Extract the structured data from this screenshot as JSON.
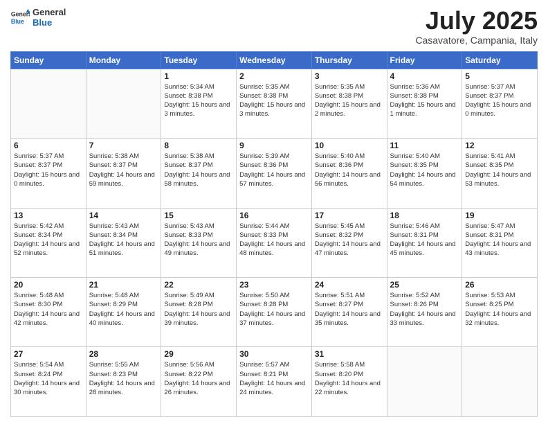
{
  "header": {
    "logo": {
      "general": "General",
      "blue": "Blue"
    },
    "title": "July 2025",
    "location": "Casavatore, Campania, Italy"
  },
  "calendar": {
    "weekdays": [
      "Sunday",
      "Monday",
      "Tuesday",
      "Wednesday",
      "Thursday",
      "Friday",
      "Saturday"
    ],
    "weeks": [
      [
        null,
        null,
        {
          "day": 1,
          "sunrise": "5:34 AM",
          "sunset": "8:38 PM",
          "daylight": "15 hours and 3 minutes."
        },
        {
          "day": 2,
          "sunrise": "5:35 AM",
          "sunset": "8:38 PM",
          "daylight": "15 hours and 3 minutes."
        },
        {
          "day": 3,
          "sunrise": "5:35 AM",
          "sunset": "8:38 PM",
          "daylight": "15 hours and 2 minutes."
        },
        {
          "day": 4,
          "sunrise": "5:36 AM",
          "sunset": "8:38 PM",
          "daylight": "15 hours and 1 minute."
        },
        {
          "day": 5,
          "sunrise": "5:37 AM",
          "sunset": "8:37 PM",
          "daylight": "15 hours and 0 minutes."
        }
      ],
      [
        {
          "day": 6,
          "sunrise": "5:37 AM",
          "sunset": "8:37 PM",
          "daylight": "15 hours and 0 minutes."
        },
        {
          "day": 7,
          "sunrise": "5:38 AM",
          "sunset": "8:37 PM",
          "daylight": "14 hours and 59 minutes."
        },
        {
          "day": 8,
          "sunrise": "5:38 AM",
          "sunset": "8:37 PM",
          "daylight": "14 hours and 58 minutes."
        },
        {
          "day": 9,
          "sunrise": "5:39 AM",
          "sunset": "8:36 PM",
          "daylight": "14 hours and 57 minutes."
        },
        {
          "day": 10,
          "sunrise": "5:40 AM",
          "sunset": "8:36 PM",
          "daylight": "14 hours and 56 minutes."
        },
        {
          "day": 11,
          "sunrise": "5:40 AM",
          "sunset": "8:35 PM",
          "daylight": "14 hours and 54 minutes."
        },
        {
          "day": 12,
          "sunrise": "5:41 AM",
          "sunset": "8:35 PM",
          "daylight": "14 hours and 53 minutes."
        }
      ],
      [
        {
          "day": 13,
          "sunrise": "5:42 AM",
          "sunset": "8:34 PM",
          "daylight": "14 hours and 52 minutes."
        },
        {
          "day": 14,
          "sunrise": "5:43 AM",
          "sunset": "8:34 PM",
          "daylight": "14 hours and 51 minutes."
        },
        {
          "day": 15,
          "sunrise": "5:43 AM",
          "sunset": "8:33 PM",
          "daylight": "14 hours and 49 minutes."
        },
        {
          "day": 16,
          "sunrise": "5:44 AM",
          "sunset": "8:33 PM",
          "daylight": "14 hours and 48 minutes."
        },
        {
          "day": 17,
          "sunrise": "5:45 AM",
          "sunset": "8:32 PM",
          "daylight": "14 hours and 47 minutes."
        },
        {
          "day": 18,
          "sunrise": "5:46 AM",
          "sunset": "8:31 PM",
          "daylight": "14 hours and 45 minutes."
        },
        {
          "day": 19,
          "sunrise": "5:47 AM",
          "sunset": "8:31 PM",
          "daylight": "14 hours and 43 minutes."
        }
      ],
      [
        {
          "day": 20,
          "sunrise": "5:48 AM",
          "sunset": "8:30 PM",
          "daylight": "14 hours and 42 minutes."
        },
        {
          "day": 21,
          "sunrise": "5:48 AM",
          "sunset": "8:29 PM",
          "daylight": "14 hours and 40 minutes."
        },
        {
          "day": 22,
          "sunrise": "5:49 AM",
          "sunset": "8:28 PM",
          "daylight": "14 hours and 39 minutes."
        },
        {
          "day": 23,
          "sunrise": "5:50 AM",
          "sunset": "8:28 PM",
          "daylight": "14 hours and 37 minutes."
        },
        {
          "day": 24,
          "sunrise": "5:51 AM",
          "sunset": "8:27 PM",
          "daylight": "14 hours and 35 minutes."
        },
        {
          "day": 25,
          "sunrise": "5:52 AM",
          "sunset": "8:26 PM",
          "daylight": "14 hours and 33 minutes."
        },
        {
          "day": 26,
          "sunrise": "5:53 AM",
          "sunset": "8:25 PM",
          "daylight": "14 hours and 32 minutes."
        }
      ],
      [
        {
          "day": 27,
          "sunrise": "5:54 AM",
          "sunset": "8:24 PM",
          "daylight": "14 hours and 30 minutes."
        },
        {
          "day": 28,
          "sunrise": "5:55 AM",
          "sunset": "8:23 PM",
          "daylight": "14 hours and 28 minutes."
        },
        {
          "day": 29,
          "sunrise": "5:56 AM",
          "sunset": "8:22 PM",
          "daylight": "14 hours and 26 minutes."
        },
        {
          "day": 30,
          "sunrise": "5:57 AM",
          "sunset": "8:21 PM",
          "daylight": "14 hours and 24 minutes."
        },
        {
          "day": 31,
          "sunrise": "5:58 AM",
          "sunset": "8:20 PM",
          "daylight": "14 hours and 22 minutes."
        },
        null,
        null
      ]
    ]
  }
}
